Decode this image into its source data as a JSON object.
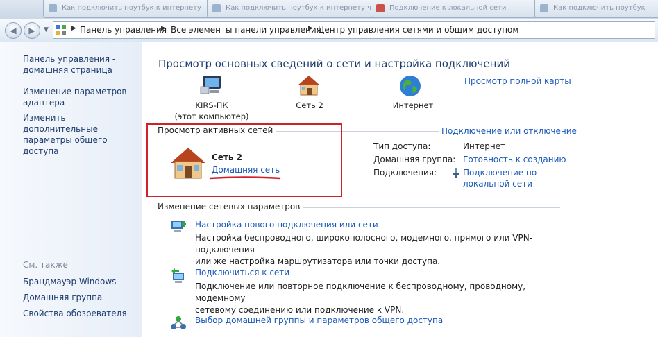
{
  "browser_tabs": [
    {
      "label": "Как подключить ноутбук к интернету"
    },
    {
      "label": "Как подключить ноутбук к интернету через"
    },
    {
      "label": "Подключение к локальной сети"
    },
    {
      "label": "Как подключить ноутбук"
    }
  ],
  "breadcrumb": {
    "items": [
      "Панель управления",
      "Все элементы панели управления",
      "Центр управления сетями и общим доступом"
    ]
  },
  "sidebar": {
    "links": [
      {
        "label": "Панель управления - домашняя страница"
      },
      {
        "label": "Изменение параметров адаптера"
      },
      {
        "label": "Изменить дополнительные параметры общего доступа"
      }
    ],
    "see_also_heading": "См. также",
    "see_also": [
      {
        "label": "Брандмауэр Windows"
      },
      {
        "label": "Домашняя группа"
      },
      {
        "label": "Свойства обозревателя"
      }
    ]
  },
  "main": {
    "title": "Просмотр основных сведений о сети и настройка подключений",
    "full_map_link": "Просмотр полной карты",
    "network_map": {
      "computer_name": "KIRS-ПК",
      "computer_sub": "(этот компьютер)",
      "network_name": "Сеть  2",
      "internet_label": "Интернет"
    },
    "active_networks": {
      "heading": "Просмотр активных сетей",
      "connect_link": "Подключение или отключение",
      "network_name": "Сеть  2",
      "network_type_link": "Домашняя сеть",
      "access_type_key": "Тип доступа:",
      "access_type_value": "Интернет",
      "home_group_key": "Домашняя группа:",
      "home_group_value": "Готовность к созданию",
      "connections_key": "Подключения:",
      "connections_value_line1": "Подключение по",
      "connections_value_line2": "локальной сети"
    },
    "change_settings": {
      "heading": "Изменение сетевых параметров",
      "tasks": [
        {
          "link": "Настройка нового подключения или сети",
          "desc_line1": "Настройка беспроводного, широкополосного, модемного, прямого или VPN-подключения",
          "desc_line2": "или же настройка маршрутизатора или точки доступа."
        },
        {
          "link": "Подключиться к сети",
          "desc_line1": "Подключение или повторное подключение к беспроводному, проводному, модемному",
          "desc_line2": "сетевому соединению или подключение к VPN."
        },
        {
          "link": "Выбор домашней группы и параметров общего доступа",
          "desc_line1": "",
          "desc_line2": ""
        }
      ]
    }
  },
  "colors": {
    "link": "#1a58b8",
    "highlight_box": "#d0202a",
    "sidebar_link": "#1f3c6e",
    "title": "#1e3e6e"
  },
  "icons": {
    "computer": "computer-icon",
    "house": "house-icon",
    "globe": "globe-icon",
    "shield": "shield-icon"
  }
}
